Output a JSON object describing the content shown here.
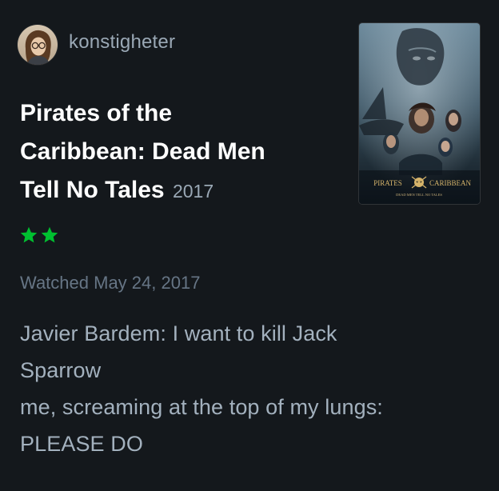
{
  "review": {
    "username": "konstigheter",
    "film": {
      "title_lines": [
        "Pirates of the",
        "Caribbean: Dead Men",
        "Tell No Tales"
      ],
      "year": "2017",
      "poster_title": "PIRATES CARIBBEAN",
      "poster_subtitle": "DEAD MEN TELL NO TALES"
    },
    "rating": {
      "stars": 2,
      "max": 5,
      "color": "#00c030"
    },
    "watched": "Watched May 24, 2017",
    "body_lines": [
      "Javier Bardem: I want to kill Jack",
      "Sparrow",
      "me, screaming at the top of my lungs:",
      "PLEASE DO"
    ]
  },
  "icons": {
    "avatar": "avatar",
    "star": "star-icon",
    "poster": "film-poster"
  },
  "colors": {
    "background": "#14181c",
    "title": "#ffffff",
    "username": "#9aa8b5",
    "muted": "#667585",
    "body": "#a3b1be",
    "star": "#00c030"
  }
}
